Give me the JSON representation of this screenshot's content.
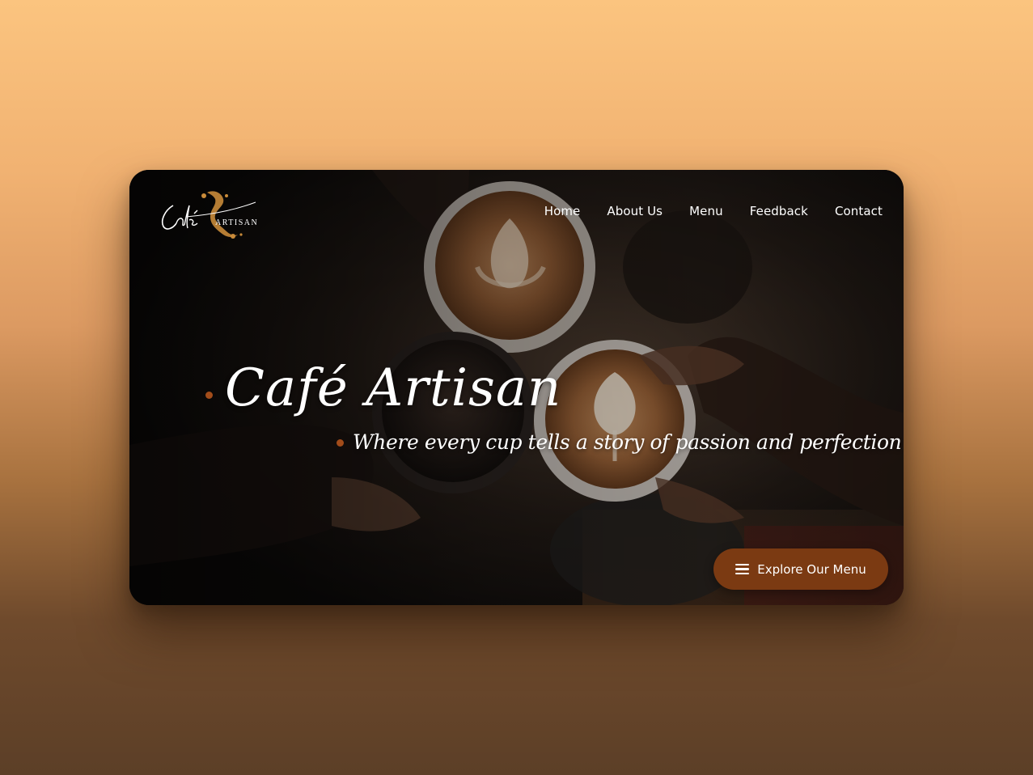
{
  "brand": {
    "logo_text_1": "Café",
    "logo_text_2": "ARTISAN"
  },
  "nav": {
    "items": [
      {
        "label": "Home"
      },
      {
        "label": "About Us"
      },
      {
        "label": "Menu"
      },
      {
        "label": "Feedback"
      },
      {
        "label": "Contact"
      }
    ]
  },
  "hero": {
    "title": "Café Artisan",
    "subtitle": "Where every cup tells a story of passion and perfection",
    "cta_label": "Explore Our Menu",
    "cta_icon": "hamburger-menu-icon"
  },
  "colors": {
    "accent": "#7b3a12",
    "dot_accent": "#a24c1a",
    "background_top": "#fbc47f",
    "background_bottom": "#5c3f27",
    "logo_gold": "#c98b3a"
  }
}
